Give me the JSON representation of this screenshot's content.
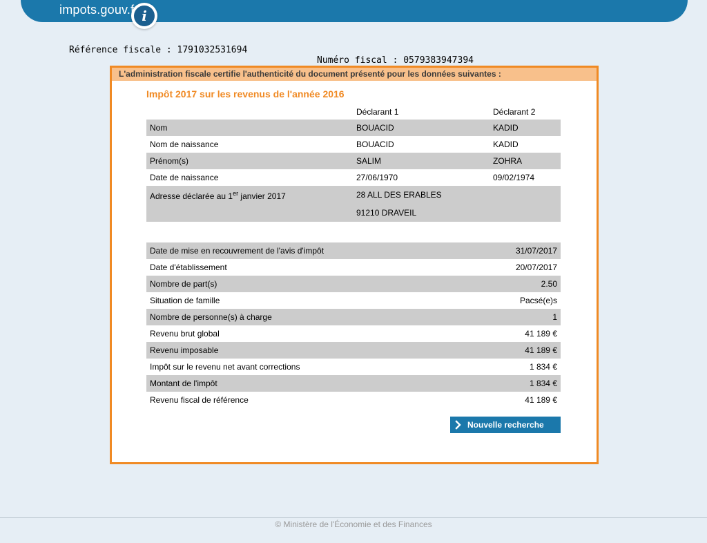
{
  "header": {
    "logo_text": "impots.gouv.fr",
    "logo_badge": "i",
    "reference_fiscale": "Référence fiscale : 1791032531694",
    "numero_fiscal": "Numéro fiscal : 0579383947394"
  },
  "panel": {
    "notice": "L'administration fiscale certifie l'authenticité du document présenté pour les données suivantes :",
    "title": "Impôt 2017 sur les revenus de l'année 2016",
    "declarant1_label": "Déclarant 1",
    "declarant2_label": "Déclarant 2",
    "identity_rows": [
      {
        "label": "Nom",
        "d1": "BOUACID",
        "d2": "KADID"
      },
      {
        "label": "Nom de naissance",
        "d1": "BOUACID",
        "d2": "KADID"
      },
      {
        "label": "Prénom(s)",
        "d1": "SALIM",
        "d2": "ZOHRA"
      },
      {
        "label": "Date de naissance",
        "d1": "27/06/1970",
        "d2": "09/02/1974"
      }
    ],
    "address": {
      "label_pre": "Adresse déclarée au 1",
      "label_sup": "er",
      "label_post": " janvier 2017",
      "line1": "28 ALL DES ERABLES",
      "line2": "91210 DRAVEIL"
    },
    "tax_rows": [
      {
        "label": "Date de mise en recouvrement de l'avis d'impôt",
        "value": "31/07/2017"
      },
      {
        "label": "Date d'établissement",
        "value": "20/07/2017"
      },
      {
        "label": "Nombre de part(s)",
        "value": "2.50"
      },
      {
        "label": "Situation de famille",
        "value": "Pacsé(e)s"
      },
      {
        "label": "Nombre de personne(s) à charge",
        "value": "1"
      },
      {
        "label": "Revenu brut global",
        "value": "41 189 €"
      },
      {
        "label": "Revenu imposable",
        "value": "41 189 €"
      },
      {
        "label": "Impôt sur le revenu net avant corrections",
        "value": "1 834 €"
      },
      {
        "label": "Montant de l'impôt",
        "value": "1 834 €"
      },
      {
        "label": "Revenu fiscal de référence",
        "value": "41 189 €"
      }
    ],
    "button_label": "Nouvelle recherche"
  },
  "footer": {
    "copyright": "© Ministère de l'Économie et des Finances"
  },
  "colors": {
    "brand_blue": "#1b78ab",
    "accent_orange": "#f08a24",
    "header_orange": "#f8c08b",
    "row_gray": "#cccccc",
    "page_bg": "#e6eef5"
  },
  "icons": {
    "logo": "info-i-icon",
    "button": "chevron-right-icon"
  }
}
